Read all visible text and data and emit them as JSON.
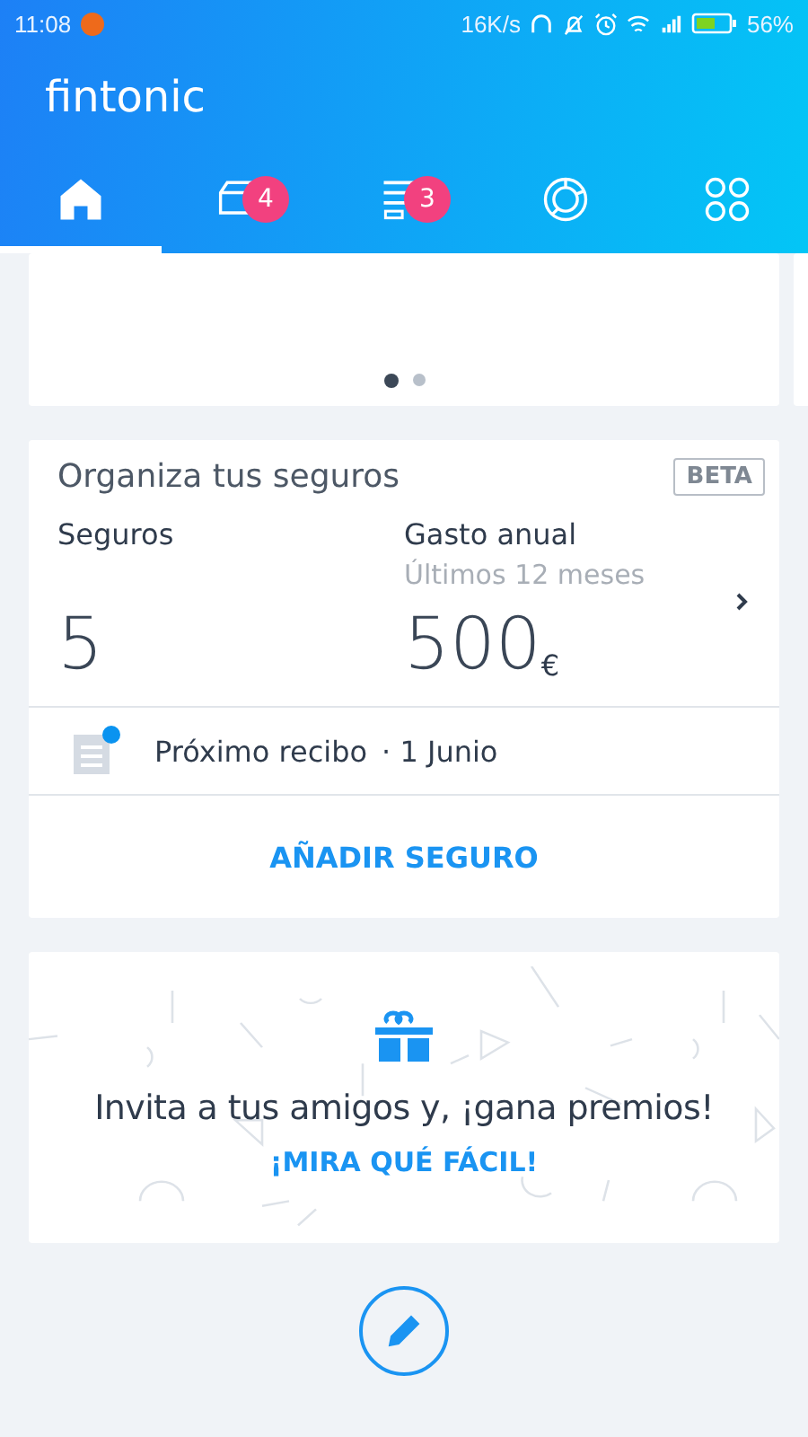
{
  "status_bar": {
    "time": "11:08",
    "speed": "16K/s",
    "battery": "56%"
  },
  "app_bar": {
    "title": "fintonic"
  },
  "tabs": [
    {
      "kind": "home",
      "selected": true
    },
    {
      "kind": "inbox",
      "selected": false,
      "badge": "4"
    },
    {
      "kind": "list",
      "selected": false,
      "badge": "3"
    },
    {
      "kind": "chart",
      "selected": false
    },
    {
      "kind": "grid",
      "selected": false
    }
  ],
  "carousel": {
    "dots": [
      {
        "selected": true
      },
      {
        "selected": false
      }
    ]
  },
  "insurance_card": {
    "title": "Organiza tus seguros",
    "tag": "BETA",
    "count_label": "Seguros",
    "count": "5",
    "spend_label": "Gasto anual",
    "spend_sublabel": "Últimos 12 meses",
    "spend_amount": "500",
    "currency": "€",
    "next_receipt": "Próximo recibo",
    "next_receipt_date": "· 1 Junio",
    "action": "AÑADIR SEGURO"
  },
  "invite_card": {
    "text": "Invita a tus amigos y, ¡gana premios!",
    "link": "¡MIRA QUÉ FÁCIL!"
  }
}
